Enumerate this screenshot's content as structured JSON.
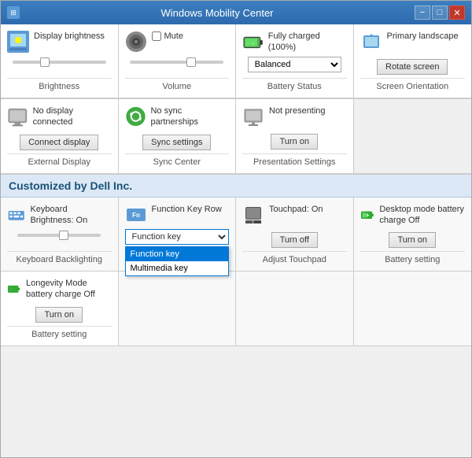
{
  "window": {
    "title": "Windows Mobility Center",
    "icon": "⊞"
  },
  "titleBar": {
    "minimize": "−",
    "maximize": "□",
    "close": "✕"
  },
  "topGrid": {
    "cells": [
      {
        "id": "brightness",
        "title": "Display brightness",
        "label": "Brightness",
        "hasSlider": true,
        "sliderPos": "30"
      },
      {
        "id": "volume",
        "title": "Mute",
        "checkboxLabel": "Mute",
        "label": "Volume",
        "hasSlider": true,
        "sliderPos": "60"
      },
      {
        "id": "battery",
        "title": "Fully charged (100%)",
        "selectValue": "Balanced",
        "label": "Battery Status"
      },
      {
        "id": "orientation",
        "title": "Primary landscape",
        "buttonLabel": "Rotate screen",
        "label": "Screen Orientation"
      }
    ]
  },
  "middleGrid": {
    "cells": [
      {
        "id": "external-display",
        "title": "No display connected",
        "buttonLabel": "Connect display",
        "label": "External Display"
      },
      {
        "id": "sync",
        "title": "No sync partnerships",
        "buttonLabel": "Sync settings",
        "label": "Sync Center"
      },
      {
        "id": "presentation",
        "title": "Not presenting",
        "buttonLabel": "Turn on",
        "label": "Presentation Settings"
      }
    ]
  },
  "customizedBar": {
    "text": "Customized by Dell Inc."
  },
  "bottomGrid": {
    "cells": [
      {
        "id": "keyboard",
        "title": "Keyboard Brightness: On",
        "label": "Keyboard Backlighting",
        "hasSlider": true
      },
      {
        "id": "fnrow",
        "title": "Function Key Row",
        "label": "",
        "dropdownValue": "Function key",
        "dropdownOptions": [
          "Function key",
          "Multimedia key"
        ]
      },
      {
        "id": "touchpad",
        "title": "Touchpad: On",
        "buttonLabel": "Turn off",
        "label": "Adjust Touchpad"
      },
      {
        "id": "desktop-battery",
        "title": "Desktop mode battery charge Off",
        "buttonLabel": "Turn on",
        "label": "Battery setting"
      }
    ]
  },
  "longevityCell": {
    "title": "Longevity Mode battery charge Off",
    "buttonLabel": "Turn on",
    "label": "Battery setting"
  }
}
